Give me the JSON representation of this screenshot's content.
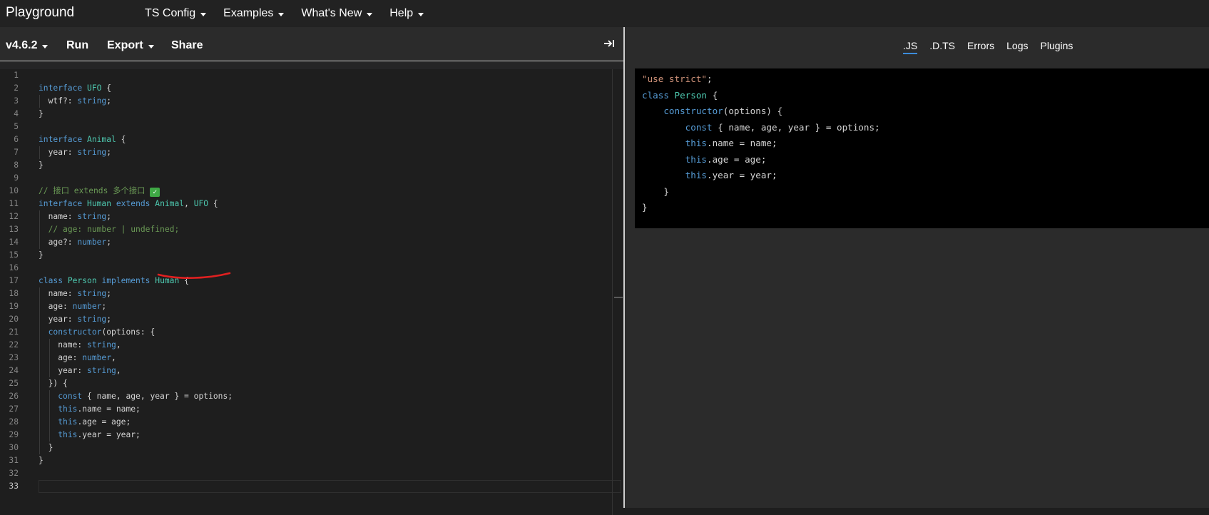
{
  "nav": {
    "brand": "Playground",
    "menu": [
      "TS Config",
      "Examples",
      "What's New",
      "Help"
    ]
  },
  "toolbar": {
    "version": "v4.6.2",
    "run": "Run",
    "export": "Export",
    "share": "Share",
    "collapse_icon": "arrow-to-right-icon"
  },
  "editor": {
    "line_numbers": [
      "1",
      "2",
      "3",
      "4",
      "5",
      "6",
      "7",
      "8",
      "9",
      "10",
      "11",
      "12",
      "13",
      "14",
      "15",
      "16",
      "17",
      "18",
      "19",
      "20",
      "21",
      "22",
      "23",
      "24",
      "25",
      "26",
      "27",
      "28",
      "29",
      "30",
      "31",
      "32",
      "33"
    ],
    "active_line": 33
  },
  "output_tabs": [
    ".JS",
    ".D.TS",
    "Errors",
    "Logs",
    "Plugins"
  ],
  "active_tab": ".JS",
  "colors": {
    "keyword": "#569cd6",
    "type": "#4ec9b0",
    "comment": "#6a9955",
    "string": "#ce9178",
    "tab_underline": "#3c8cdb",
    "annotation": "#e02020"
  }
}
